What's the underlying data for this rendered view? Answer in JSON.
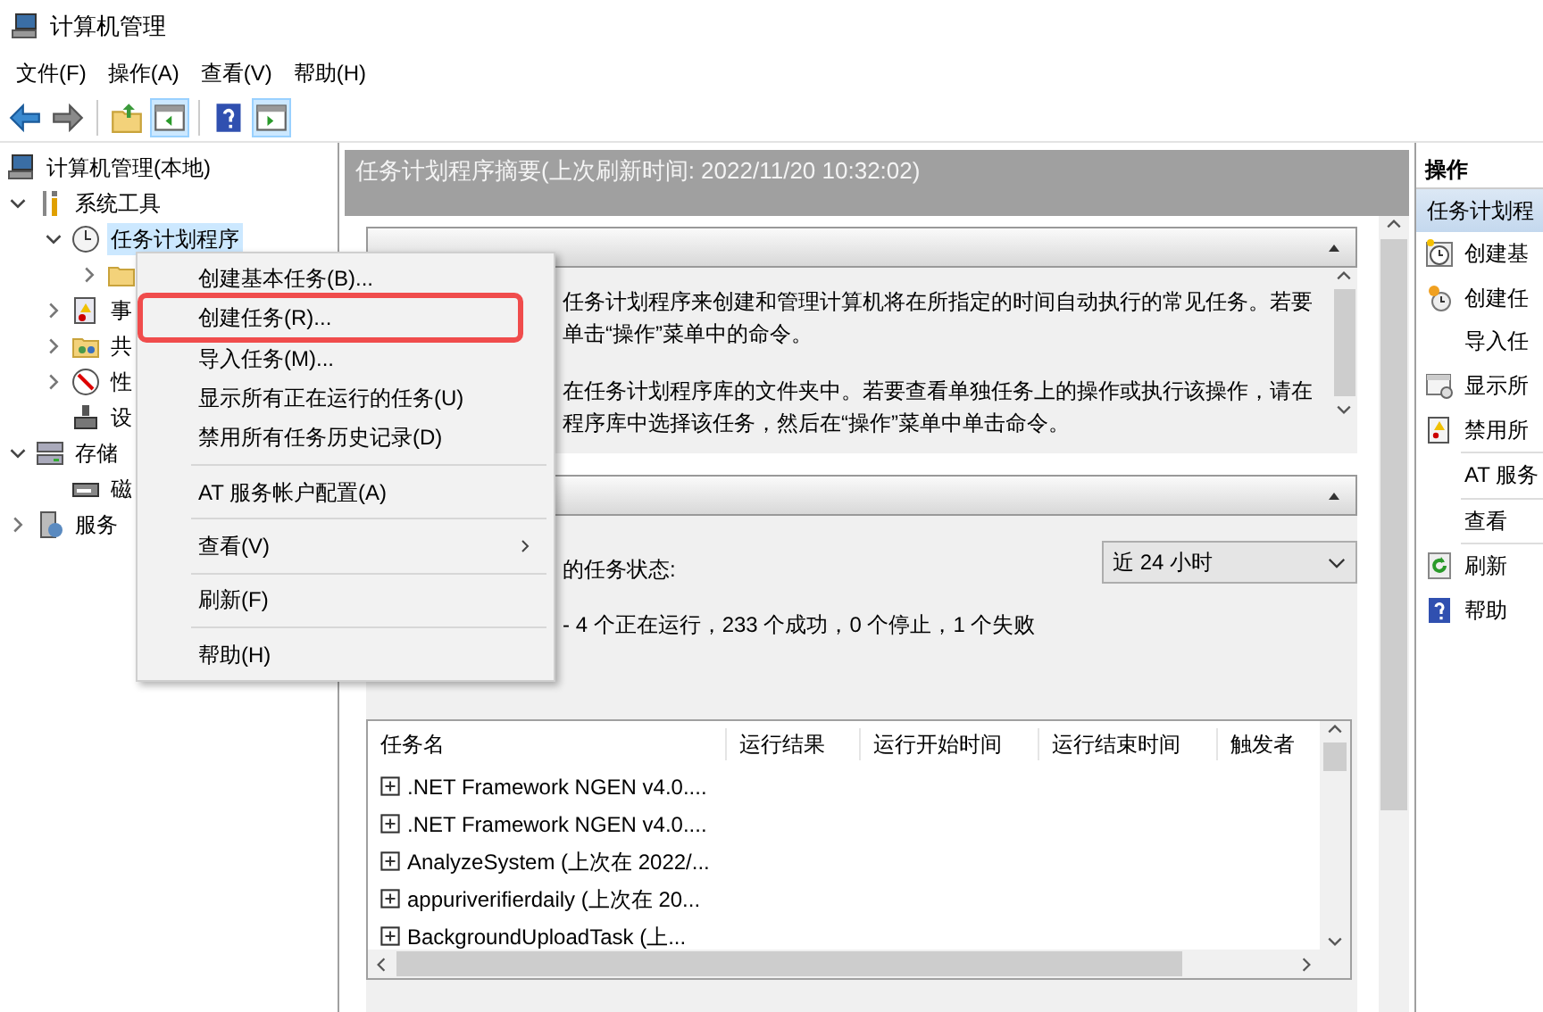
{
  "window": {
    "title": "计算机管理"
  },
  "menubar": [
    "文件(F)",
    "操作(A)",
    "查看(V)",
    "帮助(H)"
  ],
  "toolbar": [
    {
      "kind": "back",
      "pressed": false
    },
    {
      "kind": "forward",
      "pressed": false
    },
    {
      "kind": "sep"
    },
    {
      "kind": "up",
      "pressed": false
    },
    {
      "kind": "tree",
      "pressed": true
    },
    {
      "kind": "sep"
    },
    {
      "kind": "help",
      "pressed": false
    },
    {
      "kind": "pane",
      "pressed": true
    }
  ],
  "tree": [
    {
      "label": "计算机管理(本地)",
      "kind": "computer",
      "selected": false,
      "children": [
        {
          "label": "系统工具",
          "kind": "tools",
          "expanded": true,
          "selected": false,
          "children": [
            {
              "label": "任务计划程序",
              "kind": "clock",
              "expanded": true,
              "selected": true,
              "children": [
                {
                  "kind": "folder",
                  "expanded": false
                }
              ]
            },
            {
              "label": "事",
              "kind": "event",
              "expanded": false,
              "selected": false
            },
            {
              "label": "共",
              "kind": "shared",
              "expanded": false,
              "selected": false
            },
            {
              "label": "性",
              "kind": "perf",
              "expanded": false,
              "selected": false
            },
            {
              "label": "设",
              "kind": "device",
              "selected": false
            }
          ]
        },
        {
          "label": "存储",
          "kind": "storage",
          "expanded": true,
          "selected": false,
          "children": [
            {
              "label": "磁",
              "kind": "disk",
              "selected": false
            }
          ]
        },
        {
          "label": "服务",
          "kind": "services",
          "expanded": false,
          "selected": false
        }
      ]
    }
  ],
  "summary": {
    "header": "任务计划程序摘要(上次刷新时间: 2022/11/20 10:32:02)",
    "overview_lines": [
      "任务计划程序来创建和管理计算机将在所指定的时间自动执行的常见任务。若要",
      "单击“操作”菜单中的命令。",
      "在任务计划程序库的文件夹中。若要查看单独任务上的操作或执行该操作，请在",
      "程序库中选择该任务，然后在“操作”菜单中单击命令。"
    ],
    "status_label": "的任务状态:",
    "period": "近 24 小时",
    "status_line": "- 4 个正在运行，233 个成功，0 个停止，1 个失败",
    "table": {
      "columns": [
        "任务名",
        "运行结果",
        "运行开始时间",
        "运行结束时间",
        "触发者"
      ],
      "rows": [
        ".NET Framework NGEN v4.0....",
        ".NET Framework NGEN v4.0....",
        "AnalyzeSystem (上次在 2022/...",
        "appuriverifierdaily (上次在 20...",
        "BackgroundUploadTask (上..."
      ]
    }
  },
  "context_menu": [
    {
      "kind": "item",
      "label": "创建基本任务(B)...",
      "annotated": false
    },
    {
      "kind": "item",
      "label": "创建任务(R)...",
      "annotated": true
    },
    {
      "kind": "item",
      "label": "导入任务(M)...",
      "annotated": false
    },
    {
      "kind": "item",
      "label": "显示所有正在运行的任务(U)",
      "annotated": false
    },
    {
      "kind": "item",
      "label": "禁用所有任务历史记录(D)",
      "annotated": false
    },
    {
      "kind": "separator"
    },
    {
      "kind": "item",
      "label": "AT 服务帐户配置(A)",
      "annotated": false
    },
    {
      "kind": "separator"
    },
    {
      "kind": "item",
      "label": "查看(V)",
      "annotated": false,
      "submenu": true
    },
    {
      "kind": "separator"
    },
    {
      "kind": "item",
      "label": "刷新(F)",
      "annotated": false
    },
    {
      "kind": "separator"
    },
    {
      "kind": "item",
      "label": "帮助(H)",
      "annotated": false
    }
  ],
  "actions": {
    "title": "操作",
    "section": "任务计划程",
    "items": [
      {
        "label": "创建基",
        "kind": "clock-new"
      },
      {
        "label": "创建任",
        "kind": "clock-small"
      },
      {
        "label": "导入任",
        "kind": "plain"
      },
      {
        "label": "显示所",
        "kind": "window"
      },
      {
        "label": "禁用所",
        "kind": "log"
      },
      {
        "kind": "separator"
      },
      {
        "label": "AT 服务",
        "kind": "plain"
      },
      {
        "kind": "separator"
      },
      {
        "label": "查看",
        "kind": "plain"
      },
      {
        "kind": "separator"
      },
      {
        "label": "刷新",
        "kind": "refresh"
      },
      {
        "label": "帮助",
        "kind": "help"
      }
    ]
  }
}
